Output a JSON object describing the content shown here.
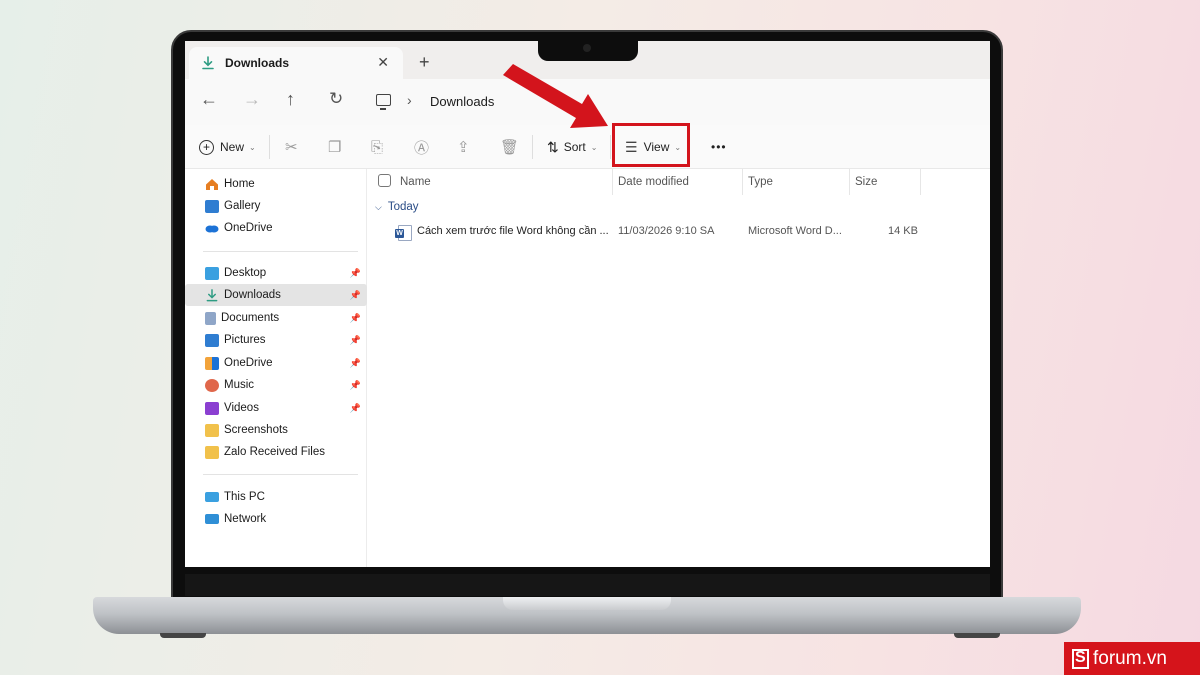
{
  "colors": {
    "highlight_red": "#d3141c",
    "accent_blue": "#2a4c86",
    "brand_red": "#d5141b"
  },
  "tab": {
    "title": "Downloads",
    "icon": "download-icon",
    "close_icon": "close-icon",
    "new_tab_icon": "plus-icon"
  },
  "addressbar": {
    "back_icon": "arrow-left-icon",
    "forward_icon": "arrow-right-icon",
    "up_icon": "arrow-up-icon",
    "refresh_icon": "refresh-icon",
    "breadcrumb": "Downloads"
  },
  "toolbar": {
    "new_label": "New",
    "sort_label": "Sort",
    "view_label": "View",
    "more_label": "•••"
  },
  "sidebar": {
    "top": [
      {
        "label": "Home",
        "icon": "home-icon"
      },
      {
        "label": "Gallery",
        "icon": "gallery-icon"
      },
      {
        "label": "OneDrive",
        "icon": "cloud-icon"
      }
    ],
    "quick": [
      {
        "label": "Desktop",
        "icon": "desktop-folder-icon",
        "pinned": true
      },
      {
        "label": "Downloads",
        "icon": "download-icon",
        "pinned": true,
        "active": true
      },
      {
        "label": "Documents",
        "icon": "documents-icon",
        "pinned": true
      },
      {
        "label": "Pictures",
        "icon": "pictures-icon",
        "pinned": true
      },
      {
        "label": "OneDrive",
        "icon": "cloud-icon",
        "pinned": true
      },
      {
        "label": "Music",
        "icon": "music-icon",
        "pinned": true
      },
      {
        "label": "Videos",
        "icon": "videos-icon",
        "pinned": true
      },
      {
        "label": "Screenshots",
        "icon": "folder-icon",
        "pinned": false
      },
      {
        "label": "Zalo Received Files",
        "icon": "folder-icon",
        "pinned": false
      }
    ],
    "bottom": [
      {
        "label": "This PC",
        "icon": "computer-icon"
      },
      {
        "label": "Network",
        "icon": "network-icon"
      }
    ]
  },
  "columns": {
    "name": "Name",
    "date": "Date modified",
    "type": "Type",
    "size": "Size"
  },
  "group": {
    "label": "Today"
  },
  "files": [
    {
      "name": "Cách xem trước file Word không cần ...",
      "date": "11/03/2026 9:10 SA",
      "type": "Microsoft Word D...",
      "size": "14 KB",
      "icon": "word-document-icon"
    }
  ],
  "brand": {
    "text": "forum.vn"
  }
}
